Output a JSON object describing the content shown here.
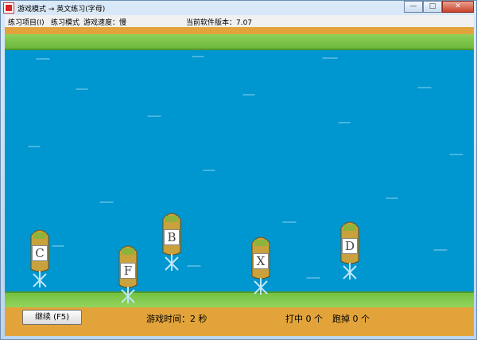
{
  "window": {
    "title": "游戏模式 → 英文练习(字母)",
    "buttons": {
      "minimize": "—",
      "maximize": "□",
      "close": "✕"
    }
  },
  "menu": {
    "items": [
      "练习项目(I)",
      "练习模式",
      "游戏速度：慢"
    ],
    "version": "当前软件版本：7.07"
  },
  "game": {
    "boats": [
      {
        "letter": "C"
      },
      {
        "letter": "F"
      },
      {
        "letter": "B"
      },
      {
        "letter": "X"
      },
      {
        "letter": "D"
      }
    ],
    "continue_label": "继续 (F5)",
    "time_label": "游戏时间：2 秒",
    "hit_label": "打中 0 个",
    "miss_label": "跑掉 0 个"
  },
  "colors": {
    "water": "#0096cf",
    "grass": "#7cc64a",
    "sand": "#e2a43a"
  }
}
